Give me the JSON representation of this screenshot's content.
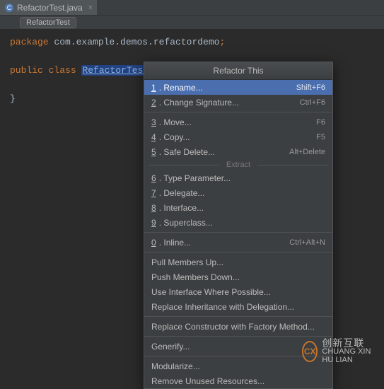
{
  "tab": {
    "filename": "RefactorTest.java",
    "close_glyph": "×"
  },
  "breadcrumb": {
    "label": "RefactorTest"
  },
  "code": {
    "kw_package": "package",
    "package_name": "com.example.demos.refactordemo",
    "kw_public": "public",
    "kw_class": "class",
    "class_name": "RefactorTest",
    "open_brace": "{",
    "close_brace": "}",
    "semicolon": ";"
  },
  "popup": {
    "title": "Refactor This",
    "section_extract": "Extract",
    "items": {
      "rename": {
        "num": "1",
        "label": "Rename...",
        "shortcut": "Shift+F6",
        "highlight": true
      },
      "changesig": {
        "num": "2",
        "label": "Change Signature...",
        "shortcut": "Ctrl+F6"
      },
      "move": {
        "num": "3",
        "label": "Move...",
        "shortcut": "F6"
      },
      "copy": {
        "num": "4",
        "label": "Copy...",
        "shortcut": "F5"
      },
      "safedelete": {
        "num": "5",
        "label": "Safe Delete...",
        "shortcut": "Alt+Delete"
      },
      "typeparam": {
        "num": "6",
        "label": "Type Parameter..."
      },
      "delegate": {
        "num": "7",
        "label": "Delegate..."
      },
      "interface": {
        "num": "8",
        "label": "Interface..."
      },
      "superclass": {
        "num": "9",
        "label": "Superclass..."
      },
      "inline": {
        "num": "0",
        "label": "Inline...",
        "shortcut": "Ctrl+Alt+N"
      },
      "pullup": {
        "label": "Pull Members Up..."
      },
      "pushdown": {
        "label": "Push Members Down..."
      },
      "useiface": {
        "label": "Use Interface Where Possible..."
      },
      "replinh": {
        "label": "Replace Inheritance with Delegation..."
      },
      "replctor": {
        "label": "Replace Constructor with Factory Method..."
      },
      "generify": {
        "label": "Generify..."
      },
      "modularize": {
        "label": "Modularize..."
      },
      "removeunused": {
        "label": "Remove Unused Resources..."
      }
    }
  },
  "watermark": {
    "logo_text": "CX",
    "line1": "创新互联",
    "line2": "CHUANG XIN HU LIAN"
  }
}
